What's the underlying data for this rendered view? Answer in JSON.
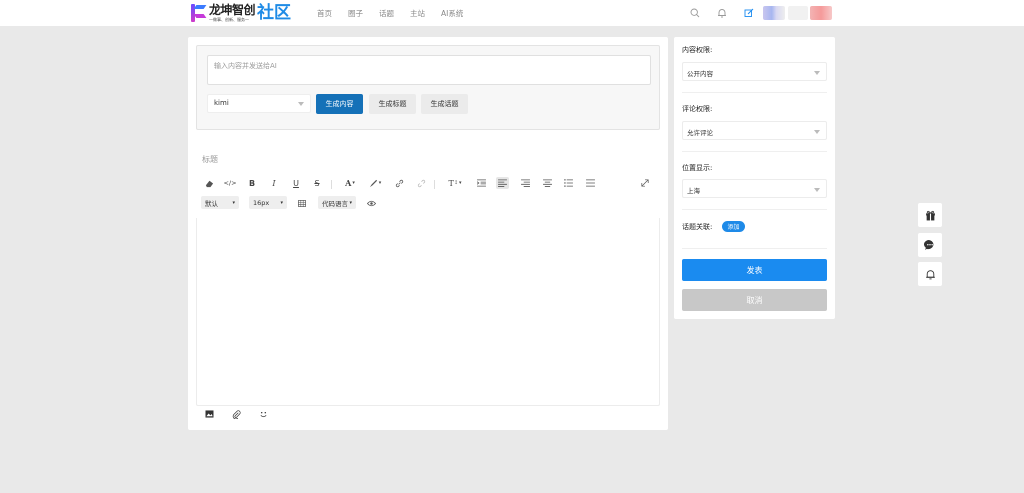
{
  "header": {
    "logo_main": "龙坤智创",
    "logo_sub": "—做事、创新、服务—",
    "logo_big": "社区",
    "nav": [
      "首页",
      "圈子",
      "话题",
      "主站",
      "AI系统"
    ]
  },
  "ai": {
    "input_placeholder": "输入内容并发送给AI",
    "model": "kimi",
    "btn_content": "生成内容",
    "btn_title": "生成标题",
    "btn_topic": "生成话题"
  },
  "editor": {
    "title_placeholder": "标题",
    "font_family": "默认",
    "font_size": "16px",
    "code_lang": "代码语言"
  },
  "side": {
    "content_perm_label": "内容权限:",
    "content_perm_value": "公开内容",
    "comment_perm_label": "评论权限:",
    "comment_perm_value": "允许评论",
    "location_label": "位置显示:",
    "location_value": "上海",
    "topic_label": "话题关联:",
    "topic_add": "添加",
    "publish": "发表",
    "cancel": "取消"
  },
  "colors": {
    "primary": "#1a8bf0",
    "ai_button": "#1571b8",
    "logo_blue": "#1f8be6"
  }
}
